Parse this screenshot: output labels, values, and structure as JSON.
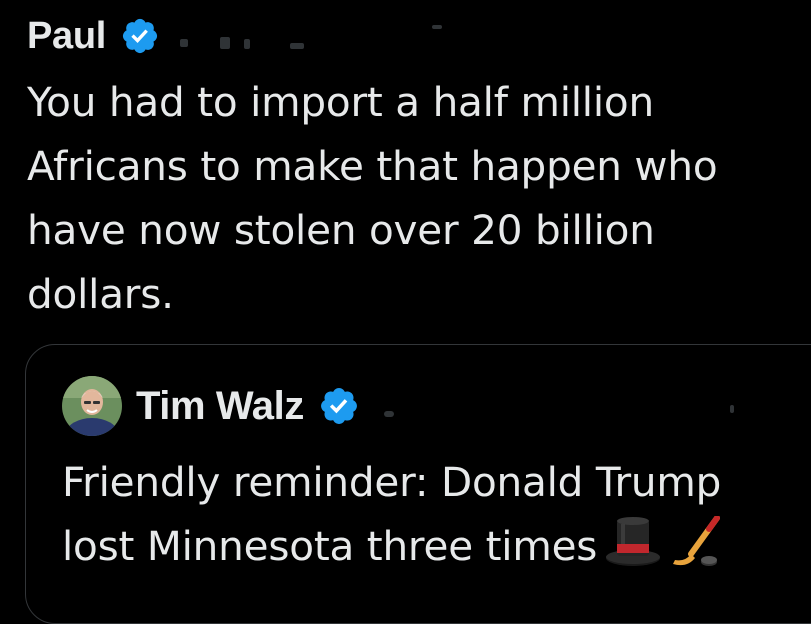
{
  "tweet": {
    "author_name": "Paul",
    "verified_icon": "verified-badge-icon",
    "text": "You had to import a half million\nAfricans to make that happen who\nhave now stolen over 20 billion\ndollars."
  },
  "quote": {
    "author_name": "Tim Walz",
    "verified_icon": "verified-badge-icon",
    "avatar": "avatar-photo",
    "text": "Friendly reminder: Donald Trump\nlost Minnesota three times",
    "emojis": [
      "top-hat-icon",
      "hockey-stick-icon"
    ]
  },
  "colors": {
    "background": "#000000",
    "text": "#e7e9ea",
    "verified_blue": "#1d9bf0",
    "card_border": "#333639"
  }
}
